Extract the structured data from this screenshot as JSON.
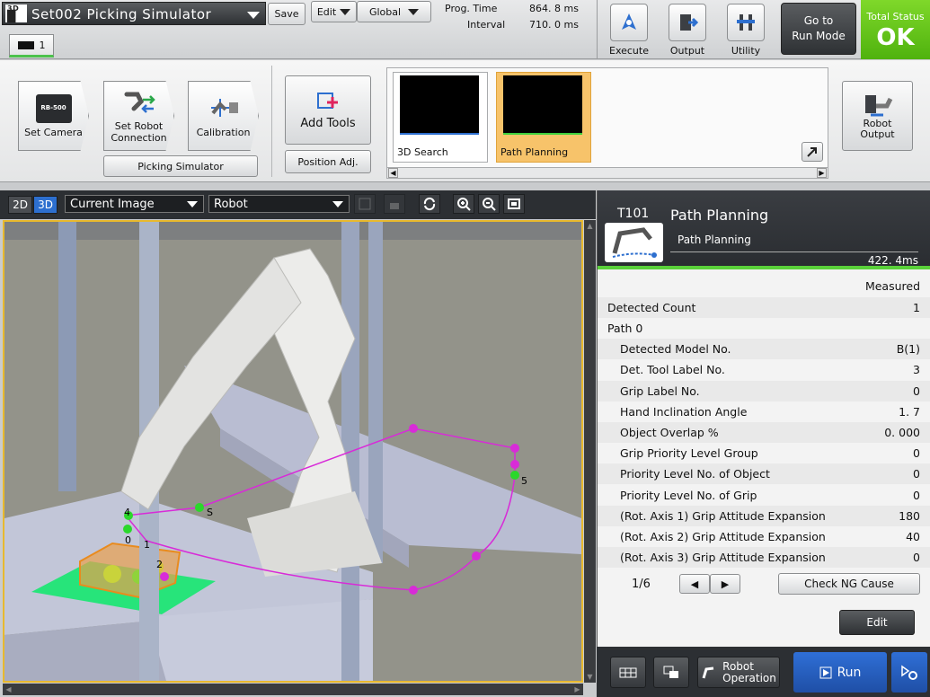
{
  "app": {
    "title": "Set002 Picking Simulator",
    "title_icon": "3D",
    "save": "Save",
    "edit": "Edit",
    "global": "Global",
    "tab_label": "1",
    "prog_time_label": "Prog. Time",
    "prog_time_value": "864. 8 ms",
    "interval_label": "Interval",
    "interval_value": "710. 0 ms",
    "execute": "Execute",
    "output": "Output",
    "utility": "Utility",
    "go_to_run_mode_line1": "Go to",
    "go_to_run_mode_line2": "Run Mode",
    "total_status_label": "Total Status",
    "total_status_value": "OK",
    "accent_ok": "#5cc41a"
  },
  "toolbar": {
    "set_camera": "Set Camera",
    "camera_model": "RB-500",
    "set_robot_line1": "Set Robot",
    "set_robot_line2": "Connection",
    "calibration": "Calibration",
    "picking_simulator": "Picking Simulator",
    "add_tools": "Add Tools",
    "position_adj": "Position Adj.",
    "tools": [
      {
        "name": "3D Search",
        "selected": false
      },
      {
        "name": "Path Planning",
        "selected": true
      }
    ],
    "robot_output_line1": "Robot",
    "robot_output_line2": "Output"
  },
  "view": {
    "mode_2d": "2D",
    "mode_3d": "3D",
    "image_select": "Current Image",
    "robot_select": "Robot",
    "point_labels": [
      "S",
      "0",
      "1",
      "2",
      "4",
      "5"
    ]
  },
  "panel": {
    "tool_id": "T101",
    "tool_title": "Path Planning",
    "tool_subtitle": "Path Planning",
    "time": "422. 4ms",
    "measured_header": "Measured",
    "rows": [
      {
        "label": "Detected Count",
        "value": "1",
        "indent": false
      },
      {
        "label": "Path 0",
        "value": "",
        "indent": false
      },
      {
        "label": "Detected Model No.",
        "value": "B(1)",
        "indent": true
      },
      {
        "label": "Det. Tool Label No.",
        "value": "3",
        "indent": true
      },
      {
        "label": "Grip Label No.",
        "value": "0",
        "indent": true
      },
      {
        "label": "Hand Inclination Angle",
        "value": "1. 7",
        "indent": true
      },
      {
        "label": "Object Overlap %",
        "value": "0. 000",
        "indent": true
      },
      {
        "label": "Grip Priority Level Group",
        "value": "0",
        "indent": true
      },
      {
        "label": "Priority Level No.  of Object",
        "value": "0",
        "indent": true
      },
      {
        "label": "Priority Level No.  of Grip",
        "value": "0",
        "indent": true
      },
      {
        "label": "(Rot. Axis 1) Grip Attitude Expansion",
        "value": "180",
        "indent": true
      },
      {
        "label": "(Rot. Axis 2) Grip Attitude Expansion",
        "value": "40",
        "indent": true
      },
      {
        "label": "(Rot. Axis 3) Grip Attitude Expansion",
        "value": "0",
        "indent": true
      }
    ],
    "page": "1/6",
    "check_ng_cause": "Check NG Cause",
    "edit": "Edit"
  },
  "bottom": {
    "robot_operation_line1": "Robot",
    "robot_operation_line2": "Operation",
    "run": "Run"
  }
}
